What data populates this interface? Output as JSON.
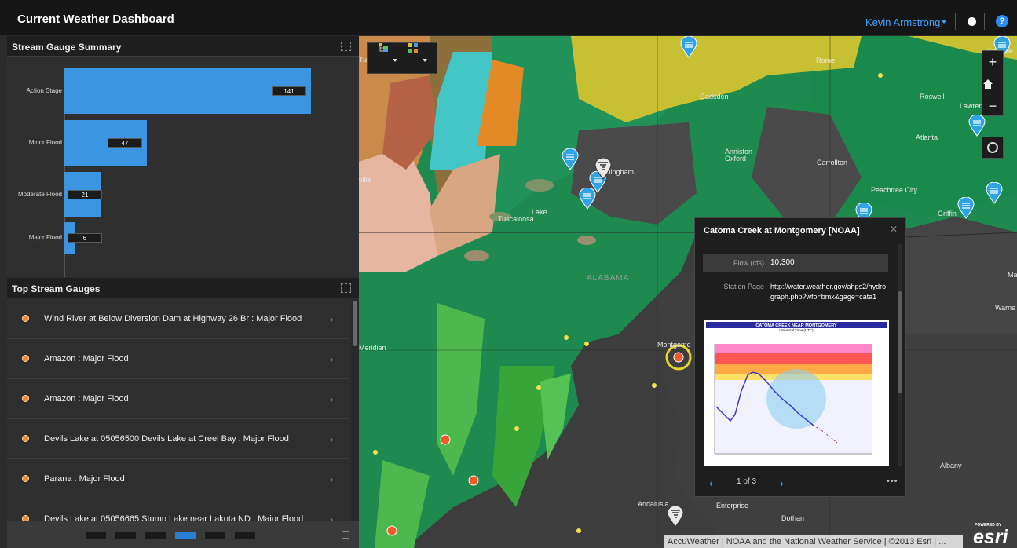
{
  "header": {
    "title": "Current Weather Dashboard",
    "user": "Kevin Armstrong"
  },
  "stream_summary": {
    "title": "Stream Gauge Summary",
    "bars": [
      {
        "label": "Action Stage",
        "value": 141
      },
      {
        "label": "Minor Flood",
        "value": 47
      },
      {
        "label": "Moderate Flood",
        "value": 21
      },
      {
        "label": "Major Flood",
        "value": 6
      }
    ],
    "bar_color": "#3b95e0"
  },
  "top_gauges": {
    "title": "Top Stream Gauges",
    "items": [
      "Wind River at Below Diversion Dam at Highway 26 Br : Major Flood",
      "Amazon : Major Flood",
      "Amazon : Major Flood",
      "Devils Lake at 05056500 Devils Lake at Creel Bay : Major Flood",
      "Parana : Major Flood",
      "Devils Lake at 05056665 Stump Lake near Lakota ND : Major Flood"
    ]
  },
  "map": {
    "labels": {
      "rome": "Rome",
      "gadsden": "Gadsden",
      "roswell": "Roswell",
      "lawrence": "Lawrence",
      "atlanta": "Atlanta",
      "anniston": "Anniston",
      "oxford": "Oxford",
      "carrollton": "Carrollton",
      "birmingham": "Birmingham",
      "peachtree": "Peachtree City",
      "griffin": "Griffin",
      "tuscaloosa": "Tuscaloosa",
      "alabama": "ALABAMA",
      "meridian": "Meridian",
      "montgomery": "Montgome",
      "albany": "Albany",
      "andalusia": "Andalusia",
      "enterprise": "Enterprise",
      "dothan": "Dothan",
      "warne": "Warne",
      "ma": "Ma",
      "ville1": "ville",
      "ville2": "ille",
      "tu": "Tu",
      "lake": "Lake",
      "ga": "Ga"
    },
    "attribution": "AccuWeather | NOAA and the National Weather Service | ©2013 Esri | ...",
    "powered_by": "POWERED BY",
    "esri": "esri"
  },
  "popup": {
    "title": "Catoma Creek at Montgomery [NOAA]",
    "flow_label": "Flow (cfs)",
    "flow_value": "10,300",
    "station_label": "Station Page",
    "station_url": "http://water.weather.gov/ahps2/hydrograph.php?wfo=bmx&gage=cata1",
    "hydro_title": "CATOMA CREEK NEAR MONTGOMERY",
    "hydro_sub": "Universal Time (UTC)",
    "pager": "1 of 3"
  }
}
